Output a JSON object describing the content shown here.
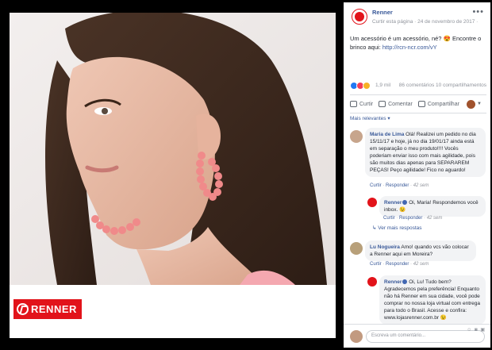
{
  "post": {
    "page_name": "Renner",
    "meta": "Curtir esta página · 24 de novembro de 2017 ·",
    "text": "Um acessório é um acessório, né? 😍 Encontre o brinco aqui: ",
    "link": "http://rcn-ncr.com/vY"
  },
  "stats": {
    "reactions": "1,9 mil",
    "comments": "86 comentários  10 compartilhamentos"
  },
  "actions": {
    "like": "Curtir",
    "comment": "Comentar",
    "share": "Compartilhar"
  },
  "sort": {
    "label": "Mais relevantes ▾"
  },
  "comments": [
    {
      "author": "Maria de Lima",
      "text": "Olá! Realizei um pedido no dia 15/11/17 e hoje, já no dia 19/01/17 ainda está em separação o meu produto!!!! Vocês poderiam enviar isso com mais agilidade, pois são muitos dias apenas para SEPARAREM PEÇAS! Peço agilidade! Fico no aguardo!",
      "meta_like": "Curtir",
      "meta_reply": "Responder",
      "meta_time": "42 sem"
    },
    {
      "author": "Renner",
      "text": "Oi, Maria! Respondemos você inbox. 😉",
      "meta_like": "Curtir",
      "meta_reply": "Responder",
      "meta_time": "42 sem"
    },
    {
      "author": "Lu Nogueira",
      "text": "Amo! quando vcs vão colocar a Renner aqui em Moreira?",
      "meta_like": "Curtir",
      "meta_reply": "Responder",
      "meta_time": "42 sem"
    },
    {
      "author": "Renner",
      "text": "Oi, Lu! Tudo bem? Agradecemos pela preferência! Enquanto não há Renner em sua cidade, você pode comprar no nossa loja virtual com entrega para todo o Brasil. Acesse e confira: www.lojasrenner.com.br 😉",
      "meta_like": "Curtir",
      "meta_reply": "Responder",
      "meta_time": "42 sem"
    }
  ],
  "replies_link": "↳ Ver mais respostas",
  "composer": {
    "placeholder": "Escreva um comentário..."
  },
  "brand": {
    "logo_text": "RENNER"
  },
  "colors": {
    "brand_red": "#e2131a",
    "link_blue": "#385898"
  }
}
